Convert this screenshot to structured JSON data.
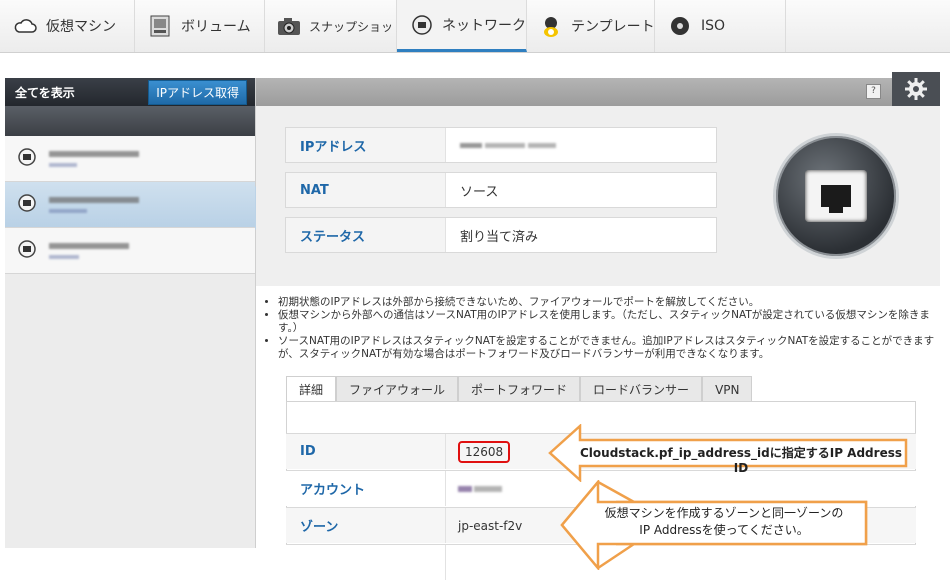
{
  "nav": {
    "tabs": [
      {
        "label": "仮想マシン",
        "icon": "cloud-icon"
      },
      {
        "label": "ボリューム",
        "icon": "volume-icon"
      },
      {
        "label": "スナップショット",
        "icon": "camera-icon"
      },
      {
        "label": "ネットワーク",
        "icon": "network-icon"
      },
      {
        "label": "テンプレート",
        "icon": "template-icon"
      },
      {
        "label": "ISO",
        "icon": "disc-icon"
      }
    ],
    "active_index": 3
  },
  "left_panel": {
    "title": "全てを表示",
    "acquire_button": "IPアドレス取得",
    "items": [
      {
        "state": "normal"
      },
      {
        "state": "selected"
      },
      {
        "state": "normal"
      }
    ]
  },
  "detail": {
    "help_label": "?",
    "fields": [
      {
        "key": "IPアドレス",
        "value": ""
      },
      {
        "key": "NAT",
        "value": "ソース"
      },
      {
        "key": "ステータス",
        "value": "割り当て済み"
      }
    ]
  },
  "notes": [
    "初期状態のIPアドレスは外部から接続できないため、ファイアウォールでポートを解放してください。",
    "仮想マシンから外部への通信はソースNAT用のIPアドレスを使用します。（ただし、スタティックNATが設定されている仮想マシンを除きます。）",
    "ソースNAT用のIPアドレスはスタティックNATを設定することができません。追加IPアドレスはスタティックNATを設定することができますが、スタティックNATが有効な場合はポートフォワード及びロードバランサーが利用できなくなります。"
  ],
  "tabs": [
    "詳細",
    "ファイアウォール",
    "ポートフォワード",
    "ロードバランサー",
    "VPN"
  ],
  "details_table": [
    {
      "key": "ID",
      "value": "12608"
    },
    {
      "key": "アカウント",
      "value": ""
    },
    {
      "key": "ゾーン",
      "value": "jp-east-f2v"
    }
  ],
  "callouts": {
    "id_note": "Cloudstack.pf_ip_address_idに指定するIP Address ID",
    "zone_note_line1": "仮想マシンを作成するゾーンと同一ゾーンの",
    "zone_note_line2": "IP Addressを使ってください。"
  },
  "colors": {
    "accent": "#1e67a8",
    "highlight": "#e01010",
    "callout_border": "#f0a04a"
  }
}
